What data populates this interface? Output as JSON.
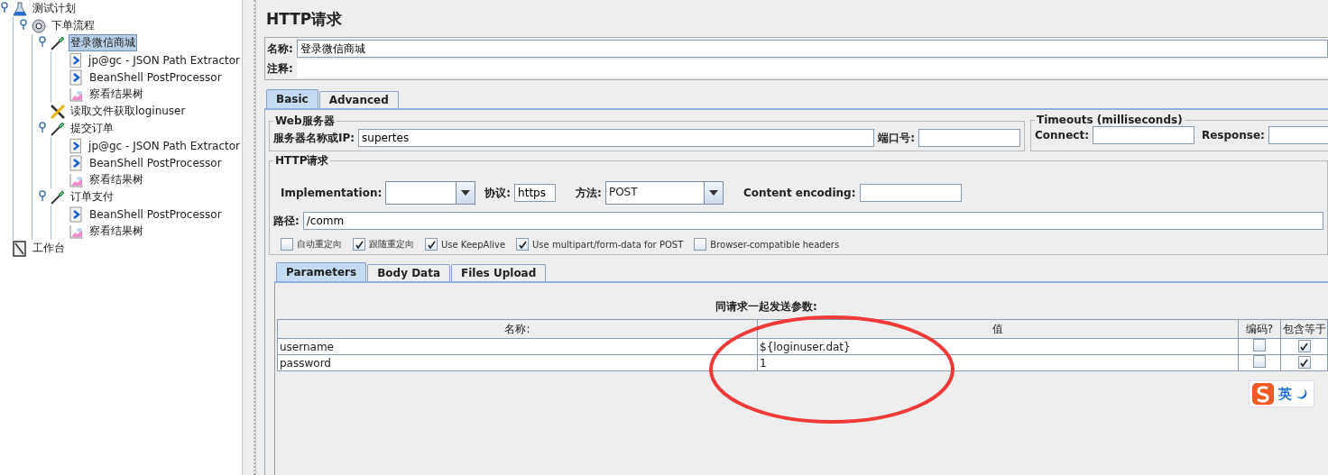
{
  "tree": [
    {
      "label": "测试计划",
      "kind": "plan",
      "selected": false,
      "expanded": true,
      "children": [
        {
          "label": "下单流程",
          "kind": "threads",
          "selected": false,
          "expanded": true,
          "children": [
            {
              "label": "登录微信商城",
              "kind": "sampler",
              "selected": true,
              "expanded": true,
              "children": [
                {
                  "label": "jp@gc - JSON Path Extractor",
                  "kind": "post",
                  "selected": false
                },
                {
                  "label": "BeanShell PostProcessor",
                  "kind": "post",
                  "selected": false
                },
                {
                  "label": "察看结果树",
                  "kind": "listener",
                  "selected": false
                }
              ]
            },
            {
              "label": "读取文件获取loginuser",
              "kind": "config",
              "selected": false
            },
            {
              "label": "提交订单",
              "kind": "sampler",
              "selected": false,
              "expanded": true,
              "children": [
                {
                  "label": "jp@gc - JSON Path Extractor",
                  "kind": "post",
                  "selected": false
                },
                {
                  "label": "BeanShell PostProcessor",
                  "kind": "post",
                  "selected": false
                },
                {
                  "label": "察看结果树",
                  "kind": "listener",
                  "selected": false
                }
              ]
            },
            {
              "label": "订单支付",
              "kind": "sampler",
              "selected": false,
              "expanded": true,
              "children": [
                {
                  "label": "BeanShell PostProcessor",
                  "kind": "post",
                  "selected": false
                },
                {
                  "label": "察看结果树",
                  "kind": "listener",
                  "selected": false
                }
              ]
            }
          ]
        }
      ]
    },
    {
      "label": "工作台",
      "kind": "workbench",
      "selected": false
    }
  ],
  "panel": {
    "title": "HTTP请求",
    "name_label": "名称:",
    "name_value": "登录微信商城",
    "comment_label": "注释:",
    "tabs": [
      {
        "label": "Basic",
        "selected": true
      },
      {
        "label": "Advanced",
        "selected": false
      }
    ],
    "web_server": {
      "legend": "Web服务器",
      "server_label": "服务器名称或IP:",
      "server_value": "supertes",
      "port_label": "端口号:"
    },
    "timeouts": {
      "legend": "Timeouts (milliseconds)",
      "connect_label": "Connect:",
      "response_label": "Response:"
    },
    "http_request": {
      "legend": "HTTP请求",
      "implementation_label": "Implementation:",
      "protocol_label": "协议:",
      "protocol_value": "https",
      "method_label": "方法:",
      "method_value": "POST",
      "encoding_label": "Content encoding:",
      "path_label": "路径:",
      "path_value": "/comm",
      "options": [
        {
          "label": "自动重定向",
          "checked": false
        },
        {
          "label": "跟随重定向",
          "checked": true
        },
        {
          "label": "Use KeepAlive",
          "checked": true
        },
        {
          "label": "Use multipart/form-data for POST",
          "checked": true
        },
        {
          "label": "Browser-compatible headers",
          "checked": false
        }
      ]
    },
    "sub_tabs": [
      {
        "label": "Parameters",
        "selected": true
      },
      {
        "label": "Body Data",
        "selected": false
      },
      {
        "label": "Files Upload",
        "selected": false
      }
    ],
    "parameters": {
      "caption": "同请求一起发送参数:",
      "columns": [
        "名称:",
        "值",
        "编码?",
        "包含等于"
      ],
      "rows": [
        {
          "name": "username",
          "value": "${loginuser.dat}",
          "encode": false,
          "include_equals": true
        },
        {
          "name": "password",
          "value": "1",
          "encode": false,
          "include_equals": true
        }
      ]
    },
    "ime": {
      "label": "英"
    }
  }
}
